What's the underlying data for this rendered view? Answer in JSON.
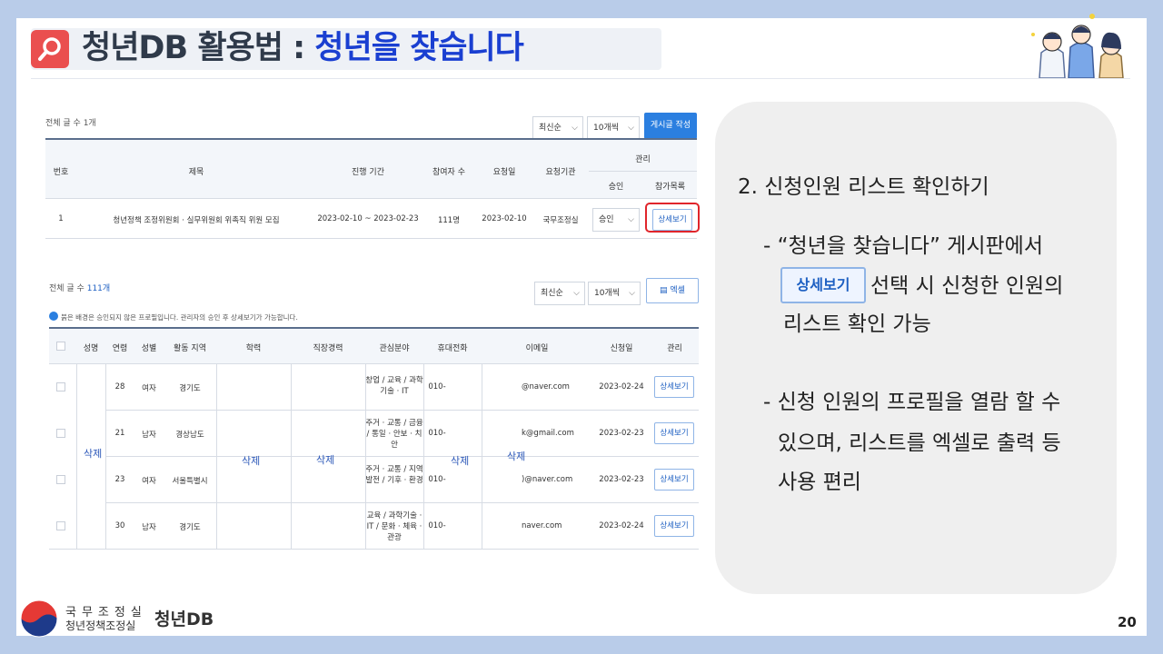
{
  "header": {
    "title_prefix": "청년DB 활용법 : ",
    "title_highlight": "청년을 찾습니다"
  },
  "board": {
    "total": "전체 글 수 1개",
    "sort": "최신순",
    "per_page": "10개씩",
    "write_button": "게시글 작성",
    "columns": [
      "번호",
      "제목",
      "진행 기간",
      "참여자 수",
      "요청일",
      "요청기관",
      "관리",
      "승인",
      "참가목록"
    ],
    "row": {
      "no": "1",
      "title": "청년정책 조정위원회 · 실무위원회 위촉직 위원 모집",
      "period": "2023-02-10 ~ 2023-02-23",
      "participants": "111명",
      "request_date": "2023-02-10",
      "agency": "국무조정실",
      "approval": "승인",
      "detail": "상세보기"
    }
  },
  "applicants": {
    "total_label": "전체 글 수",
    "total_count": "111개",
    "sort": "최신순",
    "per_page": "10개씩",
    "excel_button": "엑셀",
    "notice": "붉은 배경은 승인되지 않은 프로필입니다. 관리자의 승인 후 상세보기가 가능합니다.",
    "columns": [
      "성명",
      "연령",
      "성별",
      "활동 지역",
      "학력",
      "직장경력",
      "관심분야",
      "휴대전화",
      "이메일",
      "신청일",
      "관리"
    ],
    "deleted": "삭제",
    "rows": [
      {
        "age": "28",
        "gender": "여자",
        "region": "경기도",
        "interest": "창업 / 교육 / 과학기술 · IT",
        "phone": "010-",
        "email": "@naver.com",
        "date": "2023-02-24",
        "action": "상세보기"
      },
      {
        "age": "21",
        "gender": "남자",
        "region": "경상남도",
        "interest": "주거 · 교통 / 금융 / 통일 · 안보 · 치안",
        "phone": "010-",
        "email": "k@gmail.com",
        "date": "2023-02-23",
        "action": "상세보기"
      },
      {
        "age": "23",
        "gender": "여자",
        "region": "서울특별시",
        "interest": "주거 · 교통 / 지역발전 / 기후 · 환경",
        "phone": "010-",
        "email": ")@naver.com",
        "date": "2023-02-23",
        "action": "상세보기"
      },
      {
        "age": "30",
        "gender": "남자",
        "region": "경기도",
        "interest": "교육 / 과학기술 · IT / 문화 · 체육 · 관광",
        "phone": "010-",
        "email": "naver.com",
        "date": "2023-02-24",
        "action": "상세보기"
      }
    ]
  },
  "info": {
    "heading": "2.  신청인원 리스트 확인하기",
    "p1_line1": "- “청년을 찾습니다” 게시판에서",
    "p1_line2": "선택 시 신청한 인원의",
    "p1_line3": "리스트 확인 가능",
    "inline_button": "상세보기",
    "p2_line1": "- 신청 인원의 프로필을 열람 할 수",
    "p2_line2": "있으며, 리스트를 엑셀로 출력 등",
    "p2_line3": "사용 편리"
  },
  "footer": {
    "org": "국무조정실",
    "sub": "청년정책조정실",
    "brand": "청년DB",
    "page": "20"
  },
  "colors": {
    "accent_blue": "#1a3fd1",
    "icon_red": "#ea4f4f",
    "background": "#b9cce9"
  }
}
